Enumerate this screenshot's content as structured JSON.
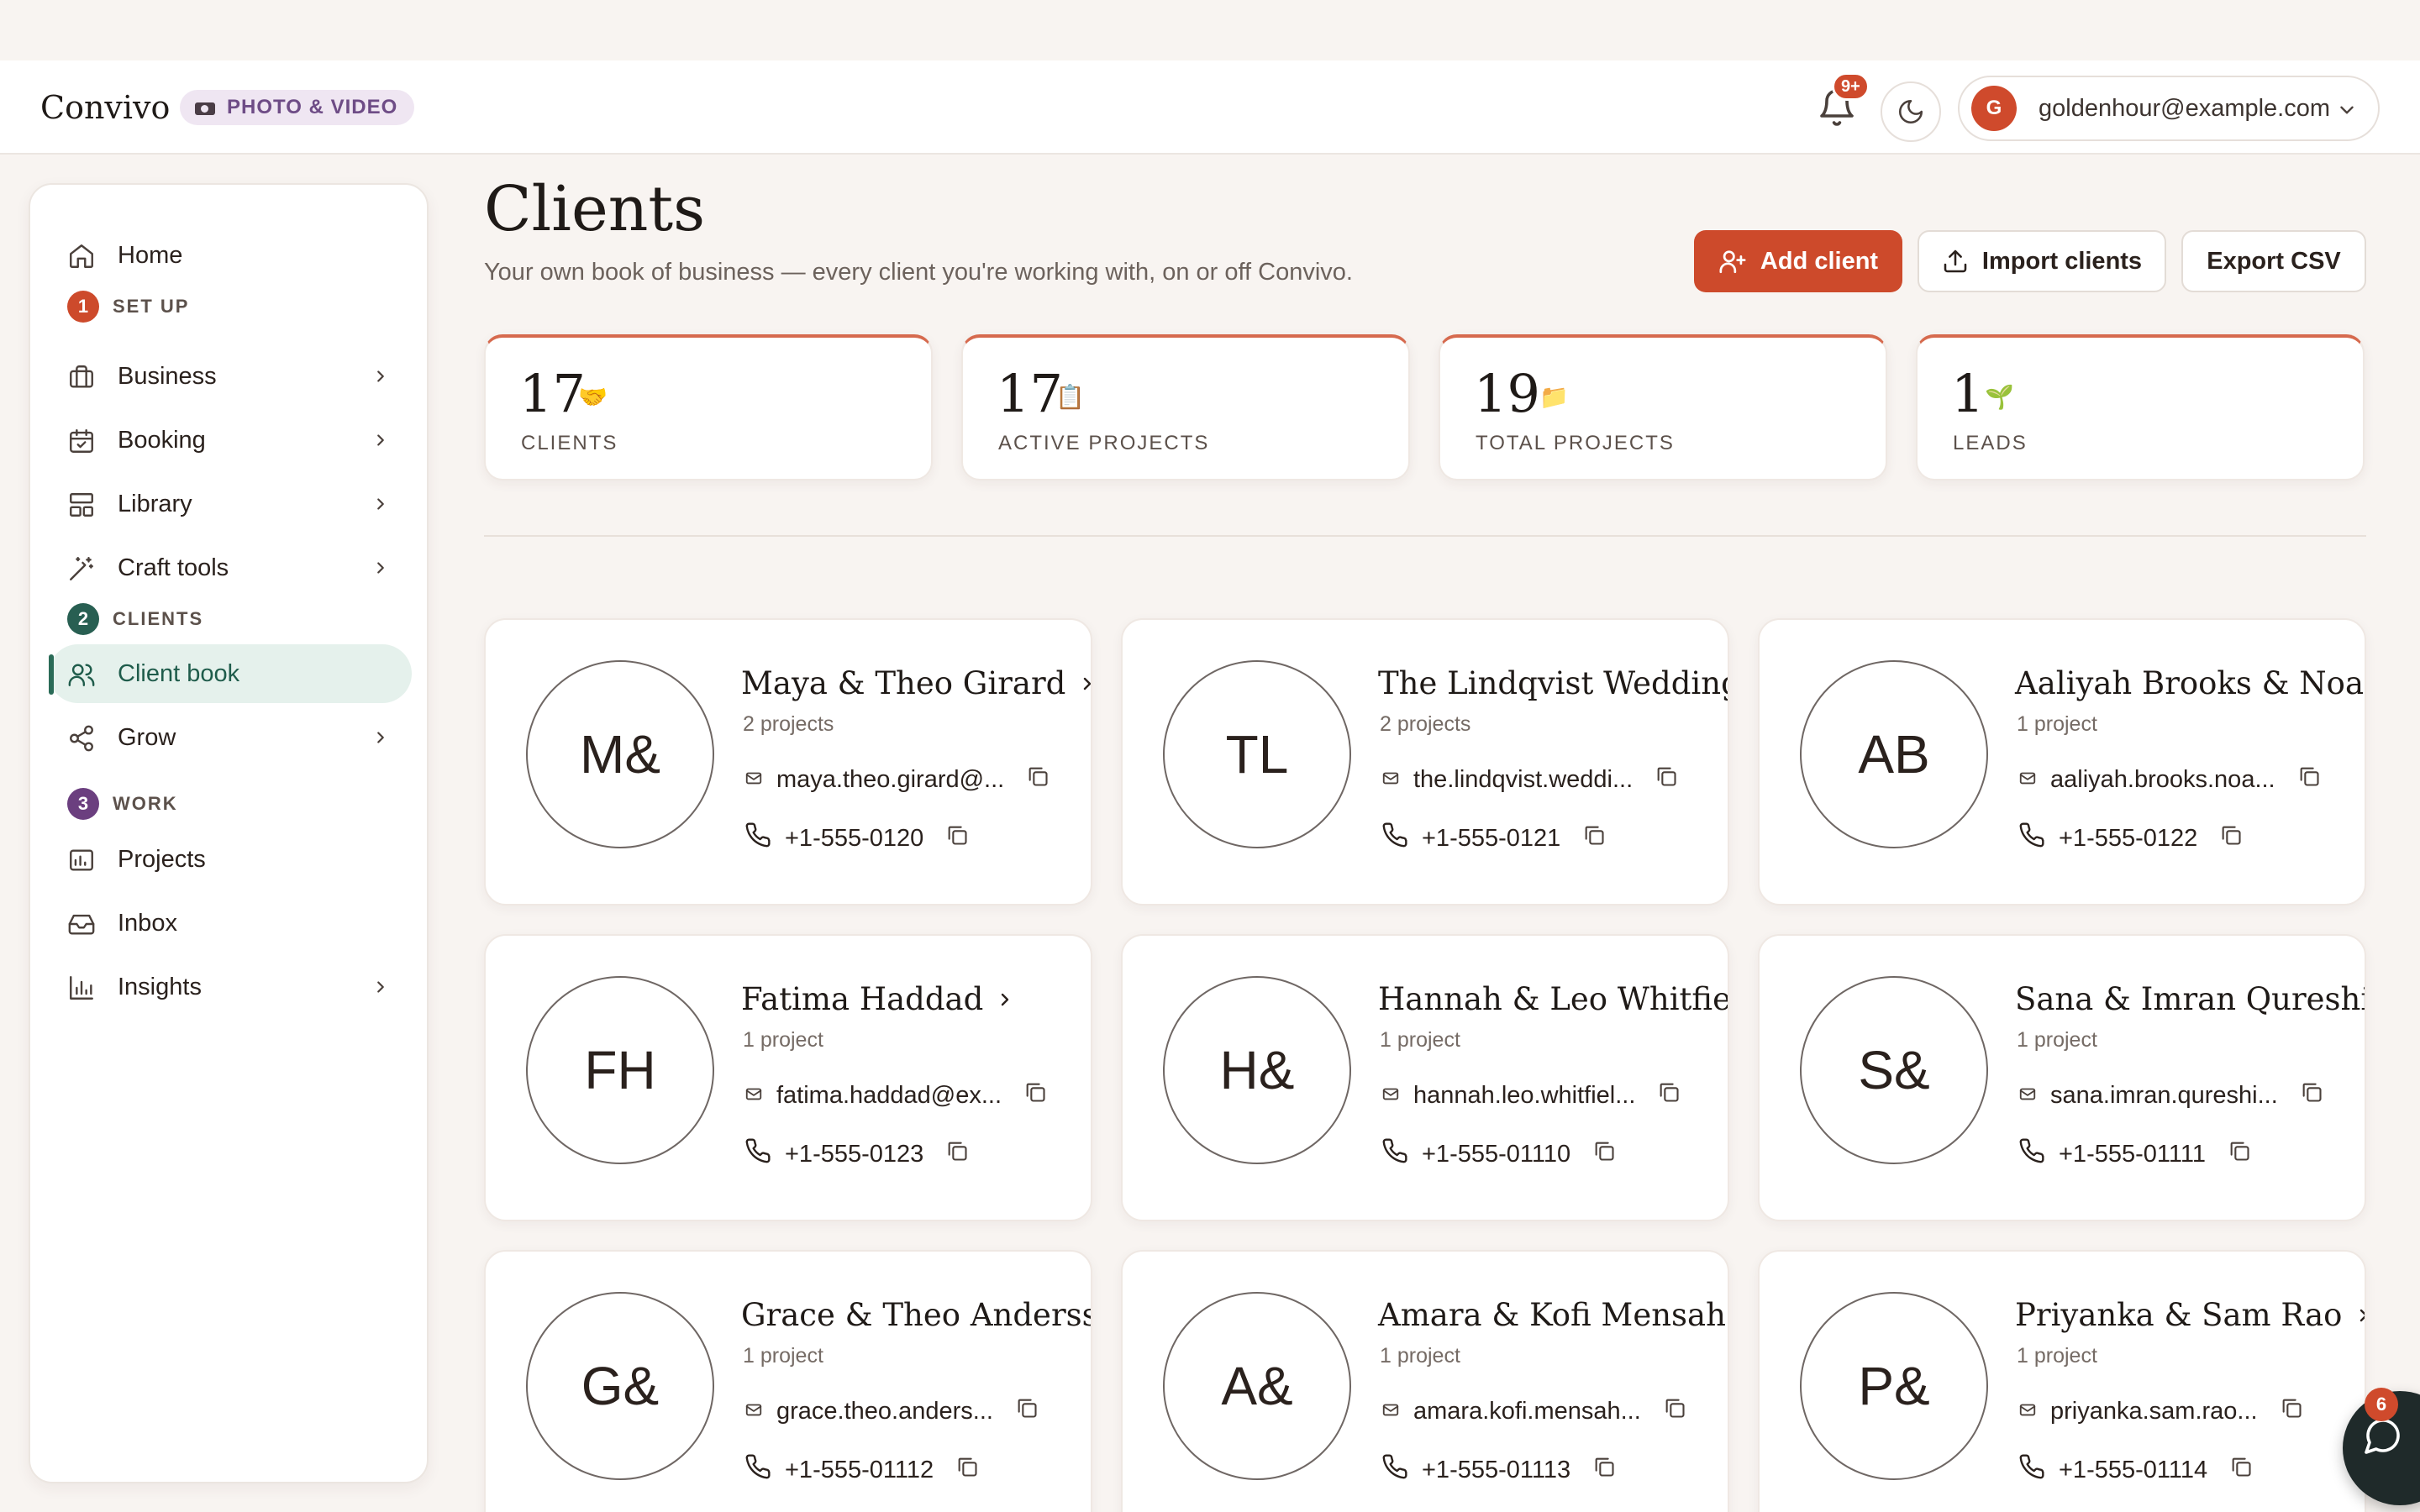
{
  "topbar": {
    "brand": "Convivo",
    "tag": "PHOTO & VIDEO",
    "notification_badge": "9+",
    "account_initial": "G",
    "account_email": "goldenhour@example.com"
  },
  "sidebar": {
    "home": "Home",
    "sections": [
      {
        "num": "1",
        "label": "SET UP",
        "color": "#cd4a2b"
      },
      {
        "num": "2",
        "label": "CLIENTS",
        "color": "#285f52"
      },
      {
        "num": "3",
        "label": "WORK",
        "color": "#6b3f7f"
      }
    ],
    "items": [
      {
        "label": "Business",
        "icon": "briefcase-icon"
      },
      {
        "label": "Booking",
        "icon": "calendar-icon"
      },
      {
        "label": "Library",
        "icon": "layout-icon"
      },
      {
        "label": "Craft tools",
        "icon": "wand-icon"
      },
      {
        "label": "Client book",
        "icon": "users-icon"
      },
      {
        "label": "Grow",
        "icon": "share-icon"
      },
      {
        "label": "Projects",
        "icon": "folder-icon"
      },
      {
        "label": "Inbox",
        "icon": "inbox-icon"
      },
      {
        "label": "Insights",
        "icon": "bar-chart-icon"
      }
    ]
  },
  "page": {
    "title": "Clients",
    "subtitle": "Your own book of business — every client you're working with, on or off Convivo.",
    "add_client": "Add client",
    "import_clients": "Import clients",
    "export_csv": "Export CSV"
  },
  "stats": [
    {
      "value": "17",
      "emoji": "🤝",
      "label": "CLIENTS"
    },
    {
      "value": "17",
      "emoji": "📋",
      "label": "ACTIVE PROJECTS"
    },
    {
      "value": "19",
      "emoji": "📁",
      "label": "TOTAL PROJECTS"
    },
    {
      "value": "1",
      "emoji": "🌱",
      "label": "LEADS"
    }
  ],
  "clients": [
    {
      "initials": "M&",
      "name": "Maya & Theo Girard",
      "projects": "2 projects",
      "email": "maya.theo.girard@...",
      "phone": "+1-555-0120"
    },
    {
      "initials": "TL",
      "name": "The Lindqvist Wedding",
      "projects": "2 projects",
      "email": "the.lindqvist.weddi...",
      "phone": "+1-555-0121"
    },
    {
      "initials": "AB",
      "name": "Aaliyah Brooks & Noah Kim",
      "projects": "1 project",
      "email": "aaliyah.brooks.noa...",
      "phone": "+1-555-0122"
    },
    {
      "initials": "FH",
      "name": "Fatima Haddad",
      "projects": "1 project",
      "email": "fatima.haddad@ex...",
      "phone": "+1-555-0123"
    },
    {
      "initials": "H&",
      "name": "Hannah & Leo Whitfield",
      "projects": "1 project",
      "email": "hannah.leo.whitfiel...",
      "phone": "+1-555-01110"
    },
    {
      "initials": "S&",
      "name": "Sana & Imran Qureshi",
      "projects": "1 project",
      "email": "sana.imran.qureshi...",
      "phone": "+1-555-01111"
    },
    {
      "initials": "G&",
      "name": "Grace & Theo Andersson",
      "projects": "1 project",
      "email": "grace.theo.anders...",
      "phone": "+1-555-01112"
    },
    {
      "initials": "A&",
      "name": "Amara & Kofi Mensah",
      "projects": "1 project",
      "email": "amara.kofi.mensah...",
      "phone": "+1-555-01113"
    },
    {
      "initials": "P&",
      "name": "Priyanka & Sam Rao",
      "projects": "1 project",
      "email": "priyanka.sam.rao...",
      "phone": "+1-555-01114"
    }
  ],
  "chat": {
    "badge": "6"
  }
}
